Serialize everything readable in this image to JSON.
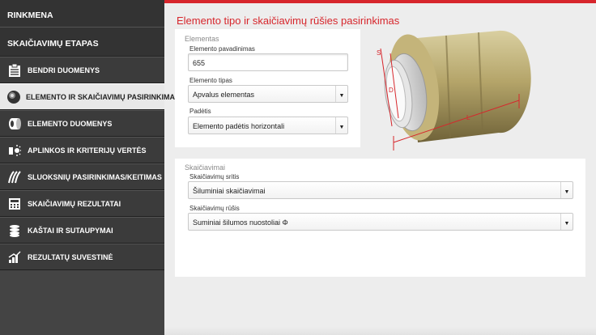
{
  "sidebar": {
    "header": "RINKMENA",
    "section": "SKAIČIAVIMŲ ETAPAS",
    "items": [
      {
        "label": "BENDRI DUOMENYS",
        "icon": "clipboard-icon"
      },
      {
        "label": "ELEMENTO IR SKAIČIAVIMŲ PASIRINKIMAS",
        "icon": "pipe-section-icon",
        "active": true
      },
      {
        "label": "ELEMENTO DUOMENYS",
        "icon": "pipe-data-icon"
      },
      {
        "label": "APLINKOS IR KRITERIJŲ VERTĖS",
        "icon": "environment-icon"
      },
      {
        "label": "SLUOKSNIŲ PASIRINKIMAS/KEITIMAS",
        "icon": "layers-icon"
      },
      {
        "label": "SKAIČIAVIMŲ REZULTATAI",
        "icon": "calculator-icon"
      },
      {
        "label": "KAŠTAI IR SUTAUPYMAI",
        "icon": "coins-icon"
      },
      {
        "label": "REZULTATŲ SUVESTINĖ",
        "icon": "chart-icon"
      }
    ]
  },
  "main": {
    "title": "Elemento tipo ir skaičiavimų rūšies pasirinkimas",
    "elements": {
      "section_title": "Elementas",
      "name_label": "Elemento pavadinimas",
      "name_value": "655",
      "type_label": "Elemento tipas",
      "type_value": "Apvalus elementas",
      "position_label": "Padėtis",
      "position_value": "Elemento padėtis horizontali"
    },
    "calculations": {
      "section_title": "Skaičiavimai",
      "area_label": "Skaičiavimų sritis",
      "area_value": "Šiluminiai skaičiavimai",
      "kind_label": "Skaičiavimų rūšis",
      "kind_value": "Suminiai šilumos nuostoliai Φ"
    },
    "diagram": {
      "dim_s": "S",
      "dim_d": "D",
      "dim_l": "L"
    }
  },
  "colors": {
    "accent": "#d7262c",
    "sidebar_bg": "#3b3b3b",
    "insulation": "#b5a56a"
  }
}
